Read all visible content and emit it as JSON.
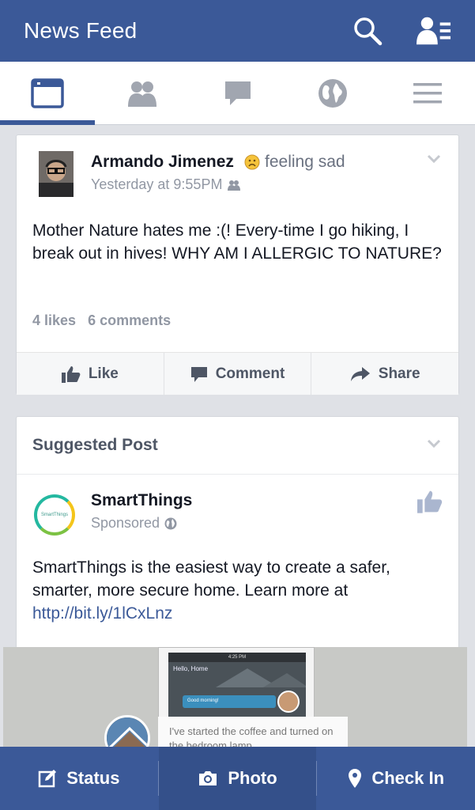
{
  "header": {
    "title": "News Feed",
    "search_icon": "search-icon",
    "friend_requests_icon": "friend-requests-icon"
  },
  "tabs": [
    {
      "name": "news-feed",
      "icon": "news-feed-icon",
      "active": true
    },
    {
      "name": "friends",
      "icon": "friends-icon",
      "active": false
    },
    {
      "name": "messages",
      "icon": "chat-bubble-icon",
      "active": false
    },
    {
      "name": "notifications",
      "icon": "globe-icon",
      "active": false
    },
    {
      "name": "more",
      "icon": "menu-icon",
      "active": false
    }
  ],
  "post": {
    "author": "Armando Jimenez",
    "feeling": "feeling sad",
    "timestamp": "Yesterday at 9:55PM",
    "body": "Mother Nature hates me :(! Every-time I go hiking, I break out in hives! WHY AM I ALLERGIC TO NATURE?",
    "likes": "4 likes",
    "comments": "6 comments",
    "actions": {
      "like": "Like",
      "comment": "Comment",
      "share": "Share"
    }
  },
  "suggested": {
    "heading": "Suggested Post",
    "page_name": "SmartThings",
    "sponsored": "Sponsored",
    "body_text": "SmartThings is the easiest way to create a safer, smarter, more secure home. Learn more at ",
    "link": "http://bit.ly/1lCxLnz",
    "logo_text": "SmartThings",
    "image": {
      "phone_status": "4:25 PM",
      "phone_greeting": "Hello, Home",
      "phone_notification": "Good morning!",
      "bubble_text": "I've started the coffee and turned on the bedroom lamp"
    }
  },
  "bottom": {
    "status": "Status",
    "photo": "Photo",
    "checkin": "Check In"
  },
  "colors": {
    "brand": "#3b5998",
    "background": "#dfe1e6",
    "link": "#3b5998"
  }
}
